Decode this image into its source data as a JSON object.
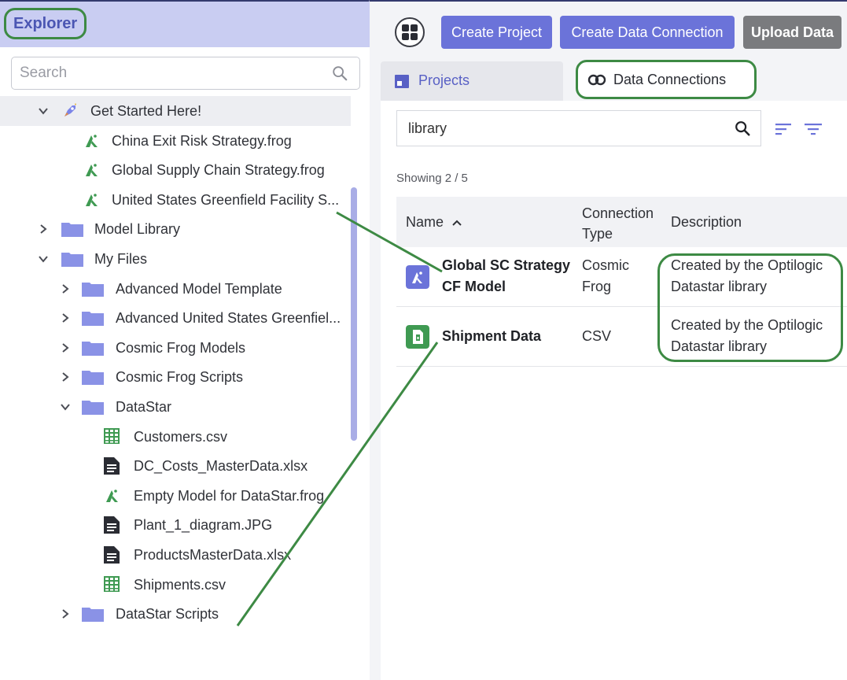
{
  "explorer": {
    "title": "Explorer",
    "search_placeholder": "Search",
    "toolbar_icons": [
      "frog-icon",
      "share-icon",
      "target-icon",
      "collapse-icon",
      "refresh-icon"
    ],
    "tree": [
      {
        "label": "Get Started Here!",
        "icon": "rocket-icon",
        "expanded": true
      },
      {
        "label": "China Exit Risk Strategy.frog",
        "icon": "frog-icon"
      },
      {
        "label": "Global Supply Chain Strategy.frog",
        "icon": "frog-icon"
      },
      {
        "label": "United States Greenfield Facility S...",
        "icon": "frog-icon"
      },
      {
        "label": "Model Library",
        "icon": "folder-icon",
        "expanded": false
      },
      {
        "label": "My Files",
        "icon": "folder-icon",
        "expanded": true
      },
      {
        "label": "Advanced Model Template",
        "icon": "folder-icon",
        "expanded": false
      },
      {
        "label": "Advanced United States Greenfiel...",
        "icon": "folder-icon",
        "expanded": false
      },
      {
        "label": "Cosmic Frog Models",
        "icon": "folder-icon",
        "expanded": false
      },
      {
        "label": "Cosmic Frog Scripts",
        "icon": "folder-icon",
        "expanded": false
      },
      {
        "label": "DataStar",
        "icon": "folder-icon",
        "expanded": true
      },
      {
        "label": "Customers.csv",
        "icon": "spreadsheet-icon"
      },
      {
        "label": "DC_Costs_MasterData.xlsx",
        "icon": "document-icon"
      },
      {
        "label": "Empty Model for DataStar.frog",
        "icon": "frog-icon"
      },
      {
        "label": "Plant_1_diagram.JPG",
        "icon": "document-icon"
      },
      {
        "label": "ProductsMasterData.xlsx",
        "icon": "document-icon"
      },
      {
        "label": "Shipments.csv",
        "icon": "spreadsheet-icon"
      },
      {
        "label": "DataStar Scripts",
        "icon": "folder-icon",
        "expanded": false
      }
    ]
  },
  "topbar": {
    "create_project": "Create Project",
    "create_connection": "Create Data Connection",
    "upload": "Upload Data"
  },
  "tabs": {
    "projects": "Projects",
    "connections": "Data Connections"
  },
  "filter": {
    "value": "library",
    "showing": "Showing 2 / 5"
  },
  "table": {
    "headers": {
      "name": "Name",
      "type": "Connection Type",
      "description": "Description"
    },
    "rows": [
      {
        "name": "Global SC Strategy CF Model",
        "type": "Cosmic Frog",
        "description": "Created by the Optilogic Datastar library",
        "icon": "frog-icon"
      },
      {
        "name": "Shipment Data",
        "type": "CSV",
        "description": "Created by the Optilogic Datastar library",
        "icon": "csv-file-icon"
      }
    ]
  },
  "colors": {
    "accent": "#6b73d9",
    "highlight": "#3d8a44",
    "folder": "#8a92e6",
    "spreadsheet": "#3f9a52"
  }
}
